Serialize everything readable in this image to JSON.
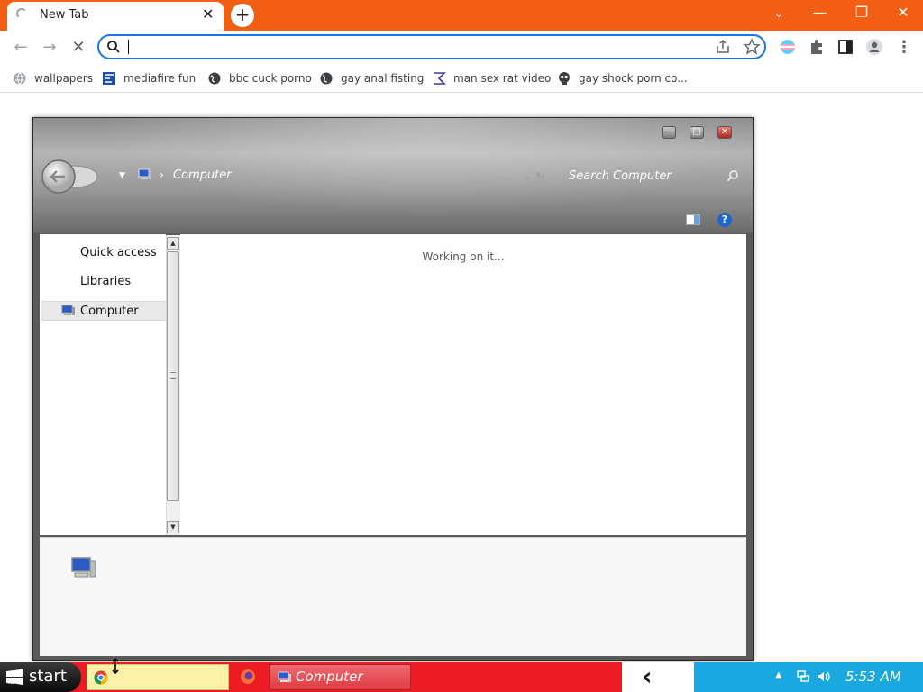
{
  "browser": {
    "tab": {
      "title": "New Tab"
    },
    "address_bar": {
      "value": "",
      "placeholder": ""
    },
    "bookmarks": [
      {
        "label": "wallpapers",
        "icon": "globe-icon"
      },
      {
        "label": "mediafire fun",
        "icon": "mediafire-icon"
      },
      {
        "label": "bbc cuck porno",
        "icon": "globe-icon"
      },
      {
        "label": "gay anal fisting",
        "icon": "globe-icon"
      },
      {
        "label": "man sex rat video",
        "icon": "sigma-icon"
      },
      {
        "label": "gay shock porn co...",
        "icon": "skull-icon"
      }
    ],
    "colors": {
      "accent": "#f25e14",
      "omnibox_focus": "#1a73e8"
    }
  },
  "explorer": {
    "breadcrumb": "Computer",
    "search_placeholder": "Search Computer",
    "nav": [
      {
        "label": "Quick access"
      },
      {
        "label": "Libraries"
      },
      {
        "label": "Computer",
        "selected": true
      }
    ],
    "status": "Working on it..."
  },
  "taskbar": {
    "start_label": "start",
    "computer_label": "Computer",
    "clock": "5:53 AM",
    "colors": {
      "bar": "#ec1c24",
      "tray": "#19a8e0"
    }
  }
}
